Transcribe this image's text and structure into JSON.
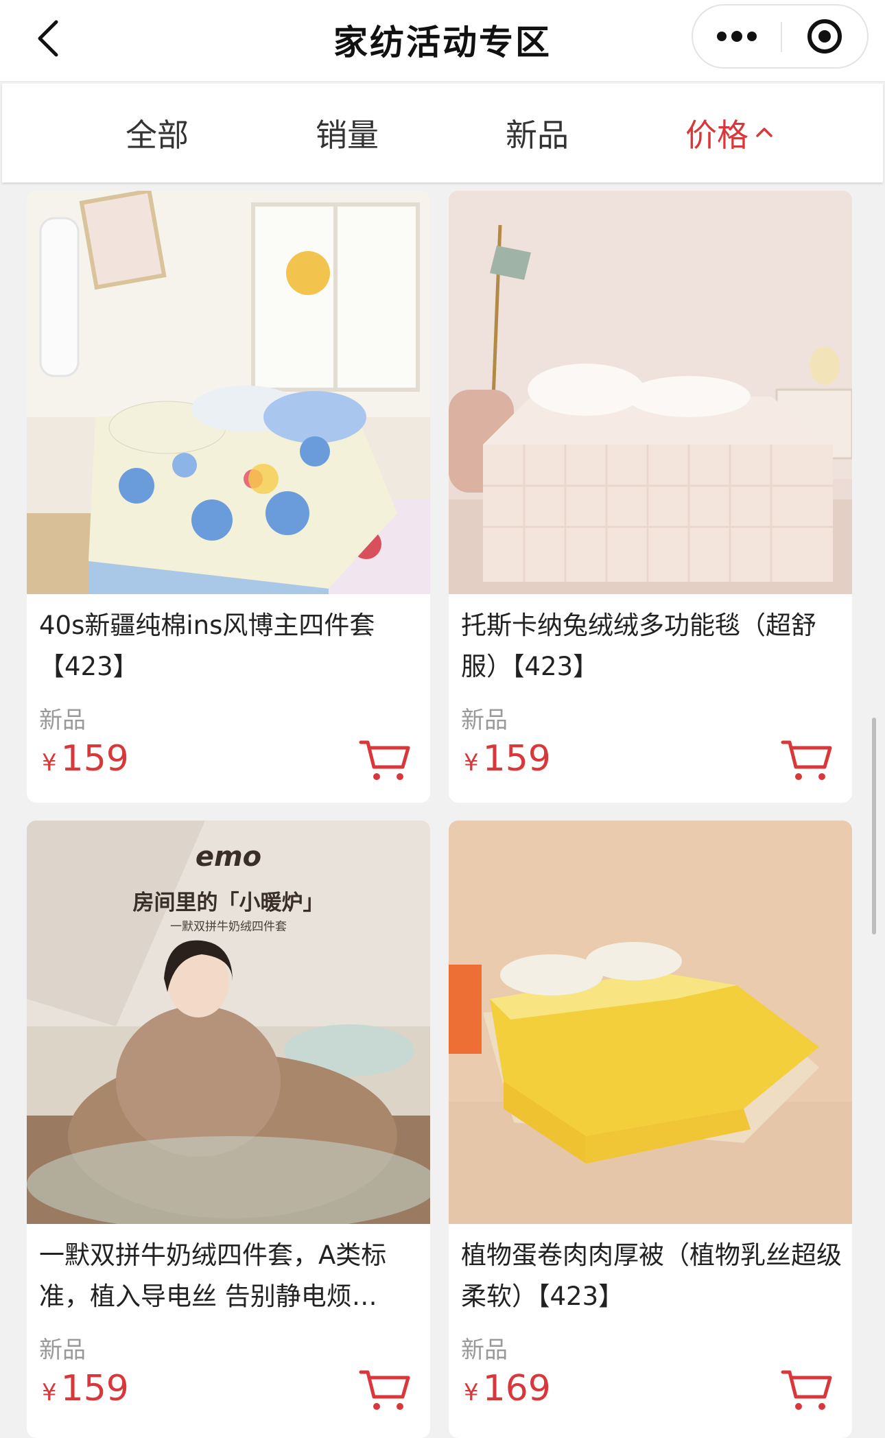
{
  "nav": {
    "title": "家纺活动专区"
  },
  "tabs": [
    {
      "label": "全部"
    },
    {
      "label": "销量"
    },
    {
      "label": "新品"
    },
    {
      "label": "价格"
    }
  ],
  "active_tab": "价格",
  "products": [
    {
      "name": "40s新疆纯棉ins风博主四件套【423】",
      "tag": "新品",
      "currency": "¥",
      "price": "159"
    },
    {
      "name": "托斯卡纳兔绒绒多功能毯（超舒服）【423】",
      "tag": "新品",
      "currency": "¥",
      "price": "159"
    },
    {
      "name": "一默双拼牛奶绒四件套，A类标准，植入导电丝 告别静电烦…",
      "tag": "新品",
      "currency": "¥",
      "price": "159",
      "image_text": {
        "brand": "emo",
        "headline": "房间里的「小暖炉」",
        "subline": "一默双拼牛奶绒四件套"
      }
    },
    {
      "name": "植物蛋卷肉肉厚被（植物乳丝超级柔软）【423】",
      "tag": "新品",
      "currency": "¥",
      "price": "169"
    }
  ],
  "colors": {
    "accent": "#d9373a",
    "page_bg": "#f1f1f1",
    "muted": "#999999"
  }
}
